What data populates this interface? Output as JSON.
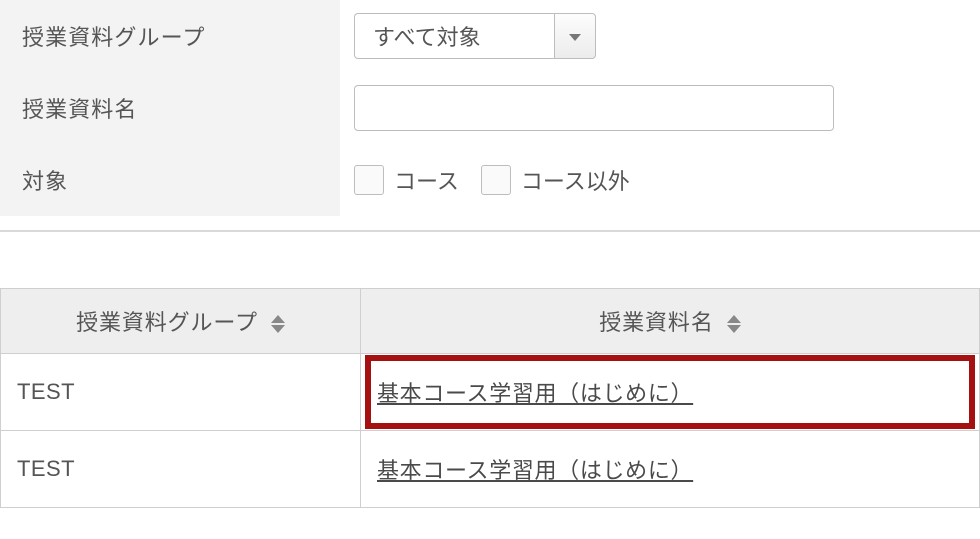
{
  "filters": {
    "group": {
      "label": "授業資料グループ",
      "selected": "すべて対象"
    },
    "name": {
      "label": "授業資料名",
      "value": ""
    },
    "target": {
      "label": "対象",
      "course_label": "コース",
      "noncourse_label": "コース以外"
    }
  },
  "table": {
    "headers": {
      "group": "授業資料グループ",
      "name": "授業資料名"
    },
    "rows": [
      {
        "group": "TEST",
        "name": "基本コース学習用（はじめに）",
        "highlight": true
      },
      {
        "group": "TEST",
        "name": "基本コース学習用（はじめに）",
        "highlight": false
      }
    ]
  }
}
